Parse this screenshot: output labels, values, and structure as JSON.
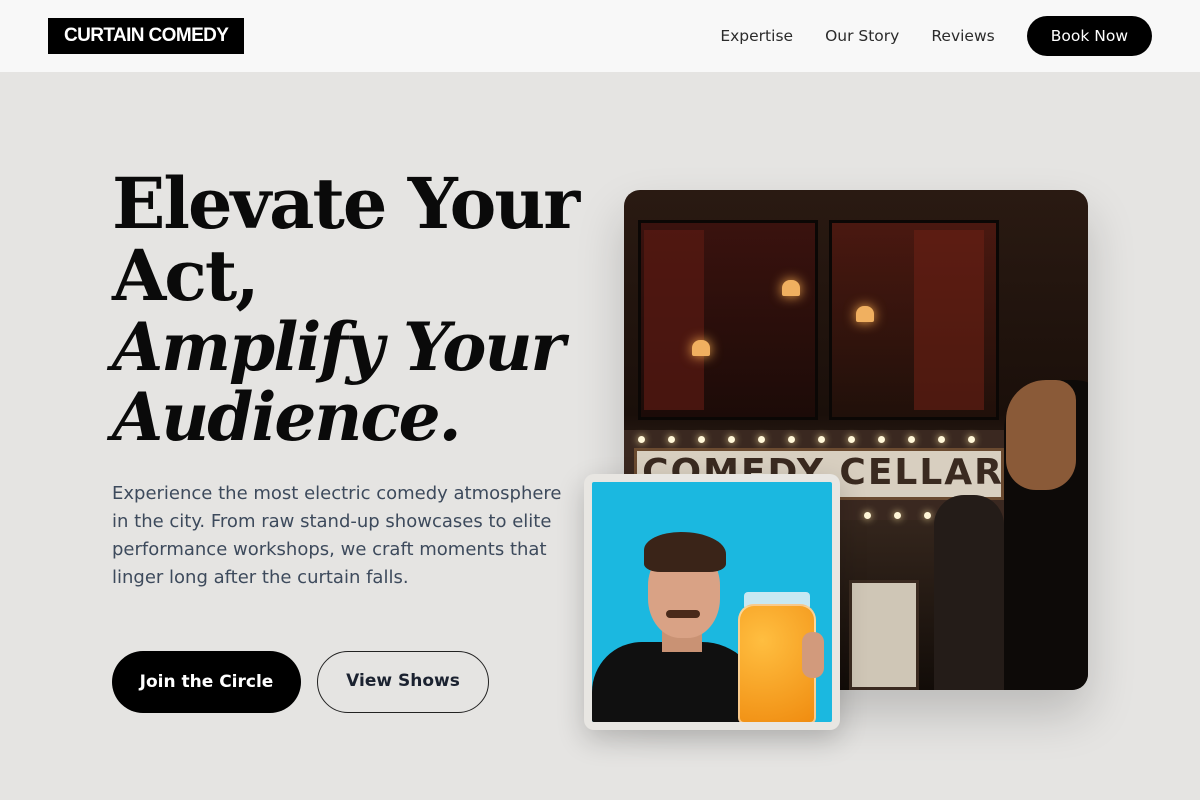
{
  "header": {
    "logo": "CURTAIN COMEDY",
    "nav": [
      "Expertise",
      "Our Story",
      "Reviews"
    ],
    "cta": "Book Now"
  },
  "hero": {
    "headline_line1": "Elevate Your",
    "headline_line2": "Act,",
    "headline_italic1": "Amplify Your",
    "headline_italic2": "Audience.",
    "description": "Experience the most electric comedy atmosphere in the city. From raw stand-up showcases to elite performance workshops, we craft moments that linger long after the curtain falls.",
    "primary_button": "Join the Circle",
    "secondary_button": "View Shows"
  },
  "images": {
    "main_sign_text": "COMEDY CELLAR"
  },
  "colors": {
    "background": "#e5e4e2",
    "header_bg": "#f8f8f8",
    "accent": "#000000",
    "body_text": "#3d4a5c",
    "inset_bg": "#1bb8e0"
  }
}
